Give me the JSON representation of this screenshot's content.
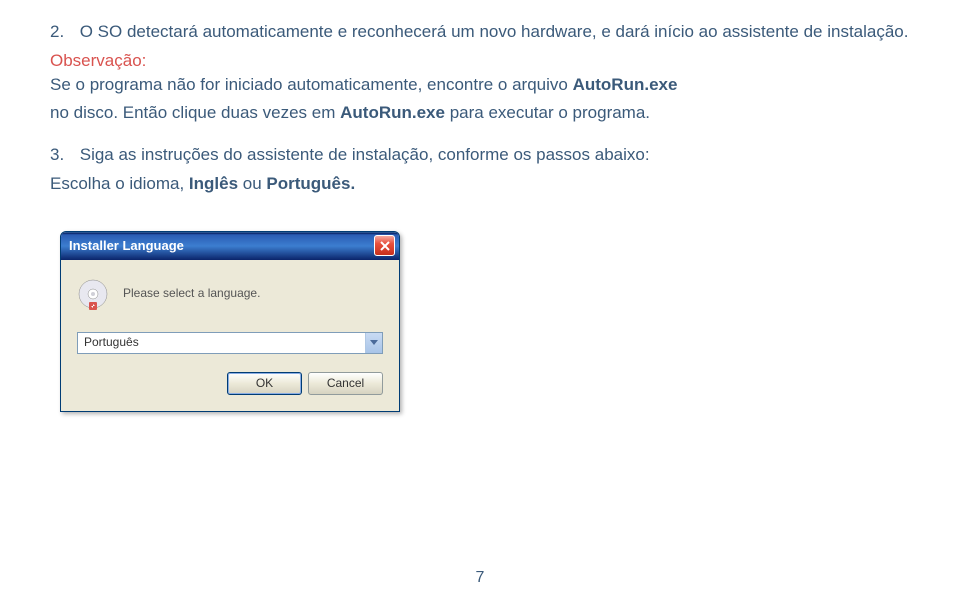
{
  "step2": {
    "number": "2.",
    "text": "O SO detectará automaticamente e reconhecerá um novo hardware, e dará início ao assistente de instalação."
  },
  "observation": {
    "title": "Observação:",
    "line1_prefix": "Se o programa não for iniciado automaticamente, encontre o arquivo ",
    "line1_bold": "AutoRun.exe",
    "line2_prefix": "no disco. Então clique duas vezes em ",
    "line2_bold": "AutoRun.exe",
    "line2_suffix": " para executar o programa."
  },
  "step3": {
    "number": "3.",
    "text_prefix": "Siga as instruções do assistente de instalação, conforme os passos abaixo:",
    "choose_prefix": "Escolha o idioma, ",
    "choose_bold1": "Inglês",
    "choose_mid": " ou ",
    "choose_bold2": "Português."
  },
  "dialog": {
    "title": "Installer Language",
    "message": "Please select a language.",
    "selected": "Português",
    "ok": "OK",
    "cancel": "Cancel"
  },
  "pageNumber": "7"
}
